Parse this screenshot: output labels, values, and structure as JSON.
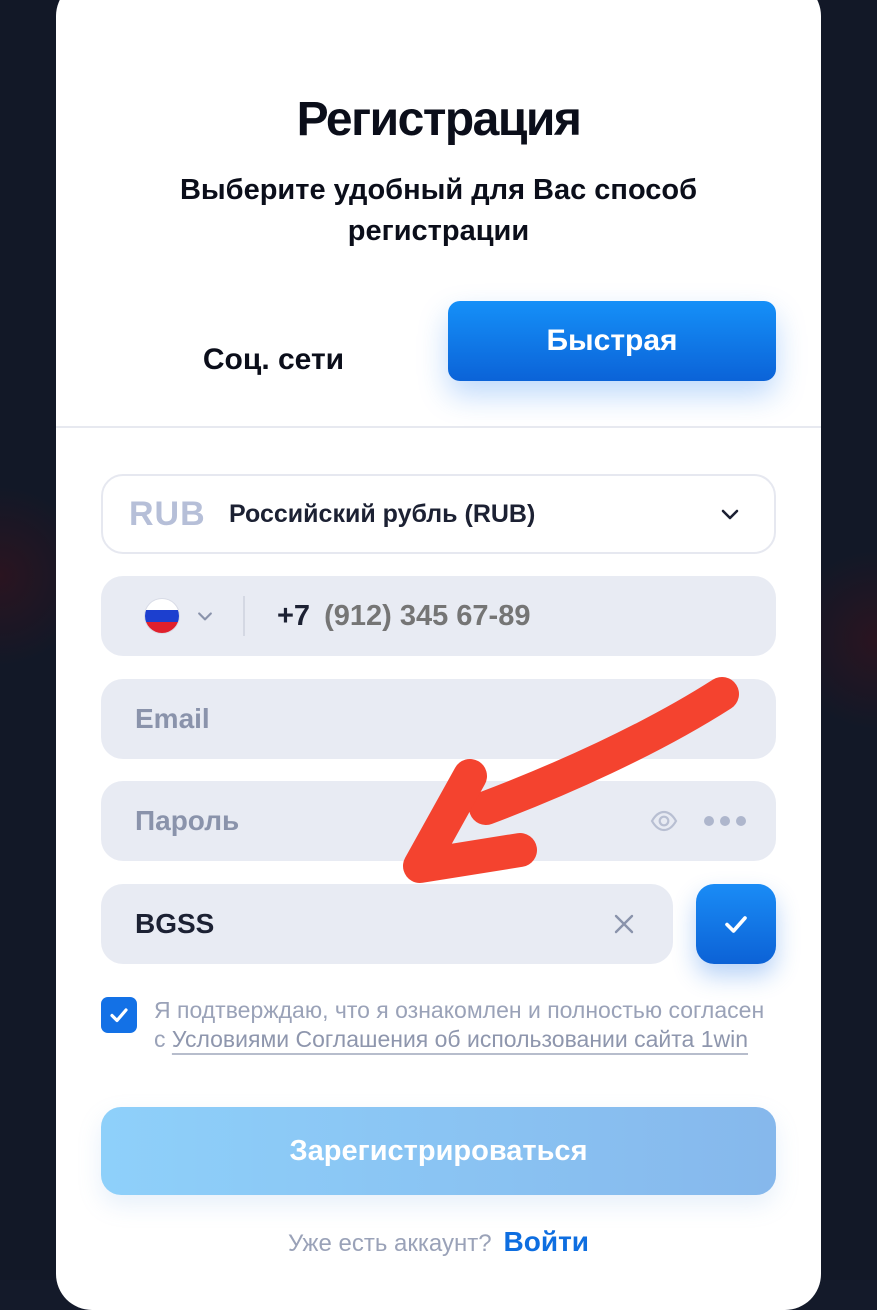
{
  "modal": {
    "title": "Регистрация",
    "subtitle": "Выберите удобный для Вас способ регистрации"
  },
  "tabs": [
    {
      "label": "Соц. сети",
      "active": false
    },
    {
      "label": "Быстрая",
      "active": true
    }
  ],
  "currency": {
    "code": "RUB",
    "name": "Российский рубль (RUB)"
  },
  "phone": {
    "country_code": "+7",
    "placeholder": "(912) 345 67-89"
  },
  "email": {
    "placeholder": "Email"
  },
  "password": {
    "placeholder": "Пароль"
  },
  "promo": {
    "value": "BGSS"
  },
  "agreement": {
    "checked": true,
    "text": "Я подтверждаю, что я ознакомлен и полностью согласен с ",
    "link": "Условиями Соглашения об использовании сайта 1win"
  },
  "submit_label": "Зарегистрироваться",
  "footer": {
    "question": "Уже есть аккаунт?",
    "login_link": "Войти"
  },
  "colors": {
    "accent": "#0b63d8",
    "annotation_arrow": "#f4432f",
    "submit_gradient_start": "#8ed0fa"
  },
  "icons": {
    "currency_chevron": "chevron-down-icon",
    "country_flag": "russia-flag-icon",
    "eye": "eye-icon",
    "clear": "close-icon",
    "check": "checkmark-icon"
  }
}
